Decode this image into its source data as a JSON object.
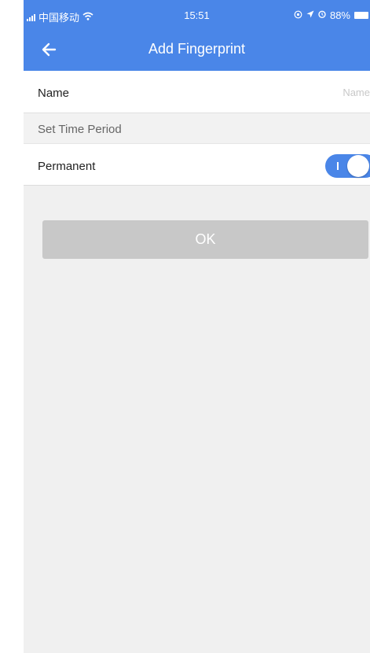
{
  "status_bar": {
    "carrier": "中国移动",
    "time": "15:51",
    "battery": "88%"
  },
  "nav": {
    "title": "Add Fingerprint"
  },
  "form": {
    "name_label": "Name",
    "name_value": "",
    "name_placeholder": "Name",
    "section_label": "Set Time Period",
    "permanent_label": "Permanent",
    "permanent_on": true
  },
  "ok_label": "OK",
  "colors": {
    "accent": "#4a86e8",
    "button_disabled": "#c8c8c8",
    "background": "#f0f0f0"
  }
}
